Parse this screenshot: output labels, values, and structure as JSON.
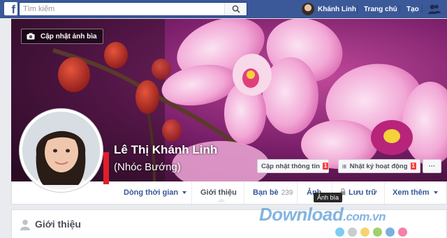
{
  "topbar": {
    "logo": "f",
    "search_placeholder": "Tìm kiếm",
    "user_name": "Khánh Linh",
    "home_label": "Trang chủ",
    "create_label": "Tạo"
  },
  "cover": {
    "update_cover_label": "Cập nhật ảnh bìa",
    "name": "Lê Thị Khánh Linh",
    "alt_name": "(Nhóc Bướng)",
    "update_info_label": "Cập nhật thông tin",
    "update_info_badge": "1",
    "activity_log_label": "Nhật ký hoạt động",
    "activity_log_badge": "1",
    "more_label": "···"
  },
  "tabs": {
    "timeline": "Dòng thời gian",
    "about": "Giới thiệu",
    "friends": "Bạn bè",
    "friends_count": "239",
    "photos": "Ảnh",
    "archive": "Lưu trữ",
    "more": "Xem thêm"
  },
  "tooltip": "Ảnh bìa",
  "intro": {
    "title": "Giới thiệu"
  },
  "watermark": {
    "brand": "Download",
    "suffix": ".com.vn"
  },
  "colors": {
    "brand": "#3b5998",
    "link": "#365899",
    "badge": "#fa3e3e",
    "dots": [
      "#5bc0eb",
      "#b9bfc4",
      "#f2c94c",
      "#8bc34a",
      "#5b9bd5",
      "#f06292"
    ]
  }
}
